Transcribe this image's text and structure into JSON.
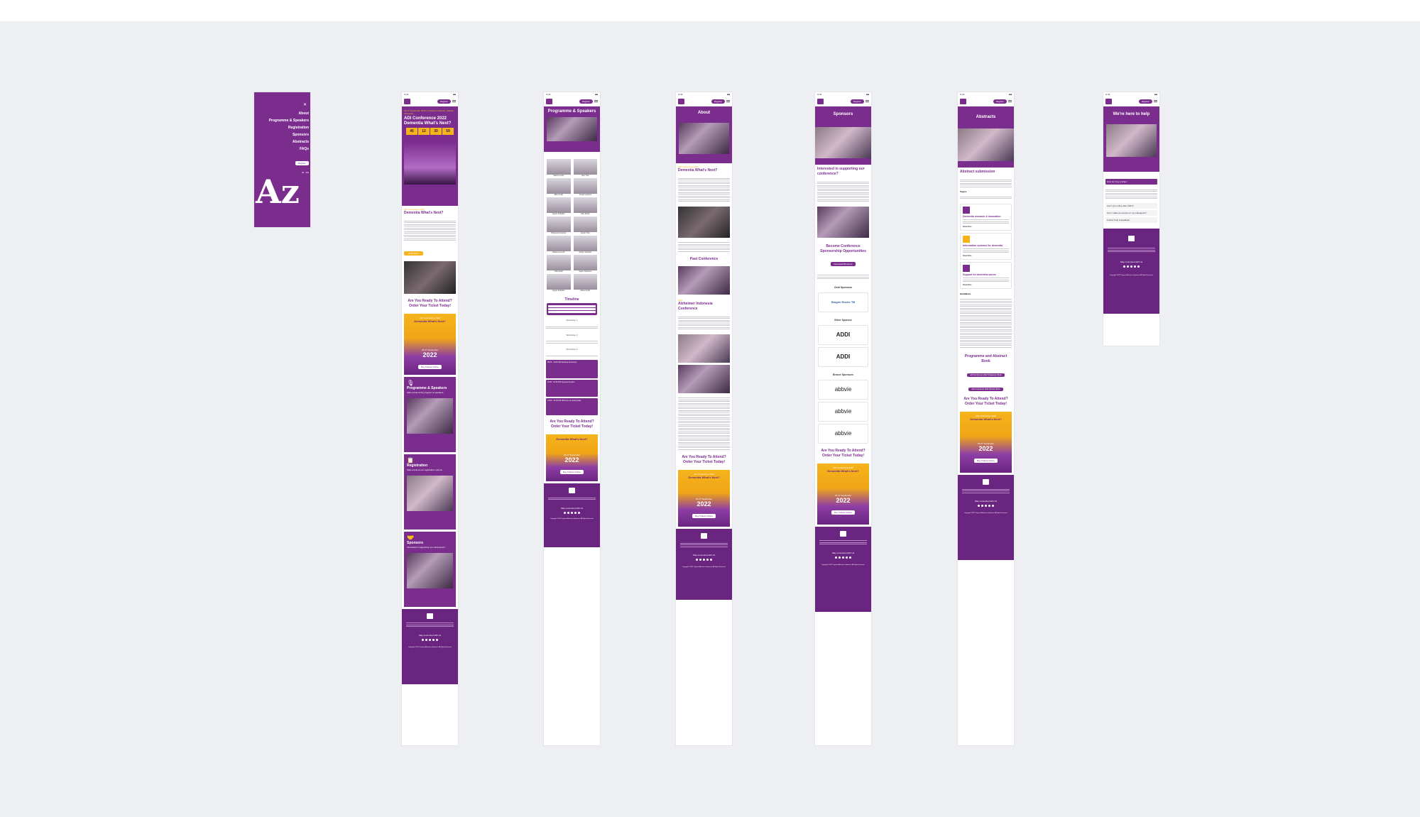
{
  "colors": {
    "brand": "#7b2d8e",
    "accent": "#f5b31c",
    "canvas": "#eeeff3"
  },
  "menu": {
    "close_icon": "close-icon",
    "items": [
      "About",
      "Programme & Speakers",
      "Registration",
      "Sponsors",
      "Abstracts",
      "FAQs"
    ],
    "register": "Register",
    "lang": [
      "ID",
      "EN"
    ],
    "logo_text": "Az"
  },
  "common": {
    "time": "9:41",
    "register": "Register",
    "cta_title": "Are You Ready To Attend? Order Your Ticket Today!",
    "banner_top": "ADI Conference 2022",
    "banner_title": "Dementia What's Next?",
    "banner_sub": "25-27 September",
    "banner_year": "2022",
    "banner_btn": "Buy Tickets Online",
    "stay_connected": "Stay connected with Us",
    "copyright": "Copyright ©2022 Yayasan Alzheimer Indonesia. All Rights Reserved."
  },
  "home": {
    "hero_small": "25-27 September 2022 | Virtual & In Person, Jakarta, Indonesia",
    "hero_title": "ADI Conference 2022 Dementia What's Next?",
    "countdown": [
      {
        "v": "45",
        "l": "Days"
      },
      {
        "v": "12",
        "l": "Hours"
      },
      {
        "v": "30",
        "l": "Minutes"
      },
      {
        "v": "59",
        "l": "Seconds"
      }
    ],
    "section_small": "ADI Conference 2022",
    "section_title": "Dementia What's Next?",
    "read_more": "Read More",
    "tiles": [
      {
        "title": "Programme & Speakers",
        "sub": "Take a look at the program & speakers"
      },
      {
        "title": "Registration",
        "sub": "Take a look at our registration options"
      },
      {
        "title": "Sponsors",
        "sub": "Interested in supporting our conference?"
      }
    ]
  },
  "programme": {
    "title": "Programme & Speakers",
    "speakers": [
      "Marcus Levitt",
      "Alex Turk",
      "Mike Smith",
      "Jordyn Lipshutz",
      "Jaylon Schleifer",
      "Alex Smith",
      "Hollywood Lipshutz",
      "Jaylon Turk",
      "Makenna Levitt",
      "Jordyn Schleifer",
      "Hiba Smith",
      "Jaylon Septimus",
      "Jaylon Schleifer",
      "Marie Smith"
    ],
    "timeline_title": "Timeline",
    "timeline_days": [
      "25 September",
      "26 September",
      "27 September"
    ],
    "workshops": [
      "Workshop 1",
      "Workshop 2",
      "Workshop 3"
    ],
    "sessions": [
      "09:00 - 11:00 AM Opening Ceremony",
      "11:00 - 12:30 PM Keynote Session",
      "13:00 - 14:30 PM What are we doing today"
    ]
  },
  "about": {
    "title": "About",
    "small": "ADI Conference 2022",
    "heading": "Dementia What's Next?",
    "past_title": "Past Conference",
    "past_small": "2021",
    "past_heading": "Alzheimer Indonesia Conference"
  },
  "sponsors": {
    "title": "Sponsors",
    "interested": "Interested in supporting our conference?",
    "become": "Become Conference Sponsorship Opportunities",
    "download": "Download Brochure",
    "gold": "Gold Sponsors",
    "gold_logo": "Biogen Roche TB",
    "silver": "Silver Sponsor",
    "silver_logo": "ADDI",
    "bronze": "Bronze Sponsors",
    "bronze_logo": "abbvie"
  },
  "abstracts": {
    "title": "Abstracts",
    "heading": "Abstract submission",
    "topics": "Topics",
    "cards": [
      {
        "title": "Dementia research & innovation",
        "more": "Read More"
      },
      {
        "title": "Information systems for dementia",
        "more": "Read More"
      },
      {
        "title": "Support for dementia carers",
        "more": "Read More"
      }
    ],
    "guidelines": "Guidelines",
    "book_title": "Programme and Abstract Book",
    "book_btns": [
      "ADI Conference 2022 Programme Book",
      "ADI Conference 2022 Abstract Book"
    ]
  },
  "help": {
    "title": "We're here to help",
    "faqs": [
      "How do I buy a ticket",
      "Can I join online after 2021?",
      "Can I make an invoice for my colleagues?",
      "Further help & feedback"
    ]
  }
}
